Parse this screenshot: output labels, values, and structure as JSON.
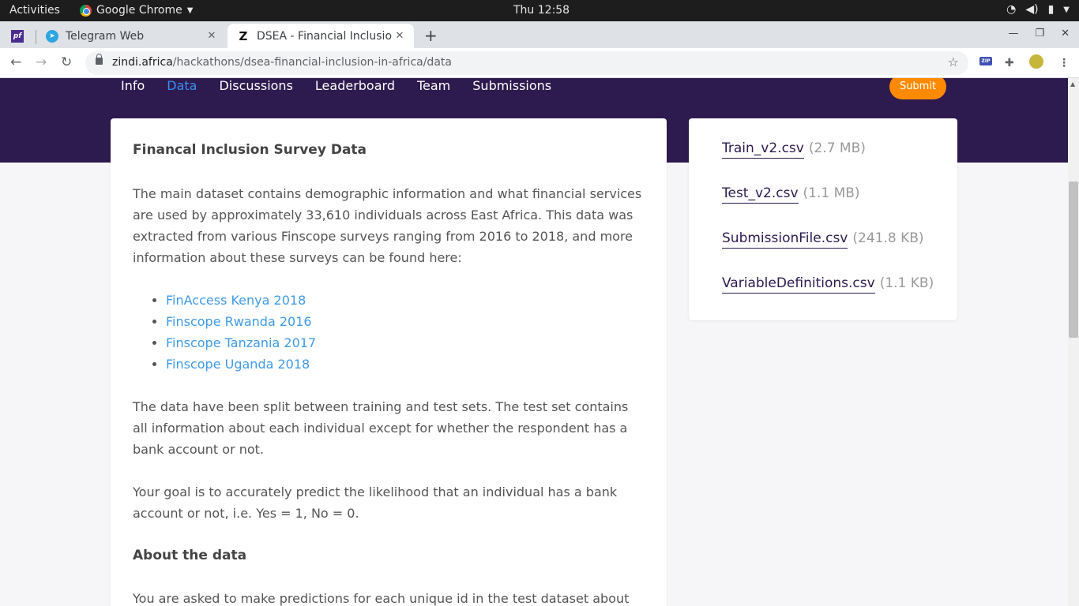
{
  "os": {
    "activities": "Activities",
    "app_name": "Google Chrome",
    "clock": "Thu 12:58"
  },
  "tabs": [
    {
      "label": "Telegram Web",
      "icon": "telegram-icon"
    },
    {
      "label": "DSEA - Financial Inclusion",
      "icon": "zindi-icon",
      "active": true
    }
  ],
  "pinned_tab_icon": "pf-icon",
  "address": {
    "host": "zindi.africa",
    "path": "/hackathons/dsea-financial-inclusion-in-africa/data"
  },
  "extensions": {
    "zip_label": "ZIP"
  },
  "subnav": {
    "items": [
      "Info",
      "Data",
      "Discussions",
      "Leaderboard",
      "Team",
      "Submissions"
    ],
    "active": "Data",
    "submit_label": "Submit"
  },
  "content": {
    "title": "Financal Inclusion Survey Data",
    "para1": "The main dataset contains demographic information and what financial services are used by approximately 33,610 individuals across East Africa. This data was extracted from various Finscope surveys ranging from 2016 to 2018, and more information about these surveys can be found here:",
    "links": [
      "FinAccess Kenya 2018",
      "Finscope Rwanda 2016",
      "Finscope Tanzania 2017",
      "Finscope Uganda 2018"
    ],
    "para2": "The data have been split between training and test sets. The test set contains all information about each individual except for whether the respondent has a bank account or not.",
    "para3": "Your goal is to accurately predict the likelihood that an individual has a bank account or not, i.e. Yes = 1, No = 0.",
    "about_heading": "About the data",
    "para4": "You are asked to make predictions for each unique id in the test dataset about the"
  },
  "files": [
    {
      "name": "Train_v2.csv",
      "size": "(2.7 MB)"
    },
    {
      "name": "Test_v2.csv",
      "size": "(1.1 MB)"
    },
    {
      "name": "SubmissionFile.csv",
      "size": "(241.8 KB)"
    },
    {
      "name": "VariableDefinitions.csv",
      "size": "(1.1 KB)"
    }
  ],
  "colors": {
    "hero": "#2d1a4f",
    "submit": "#ff8a00",
    "active_nav": "#3b8ef0",
    "link": "#3f9ae5"
  }
}
